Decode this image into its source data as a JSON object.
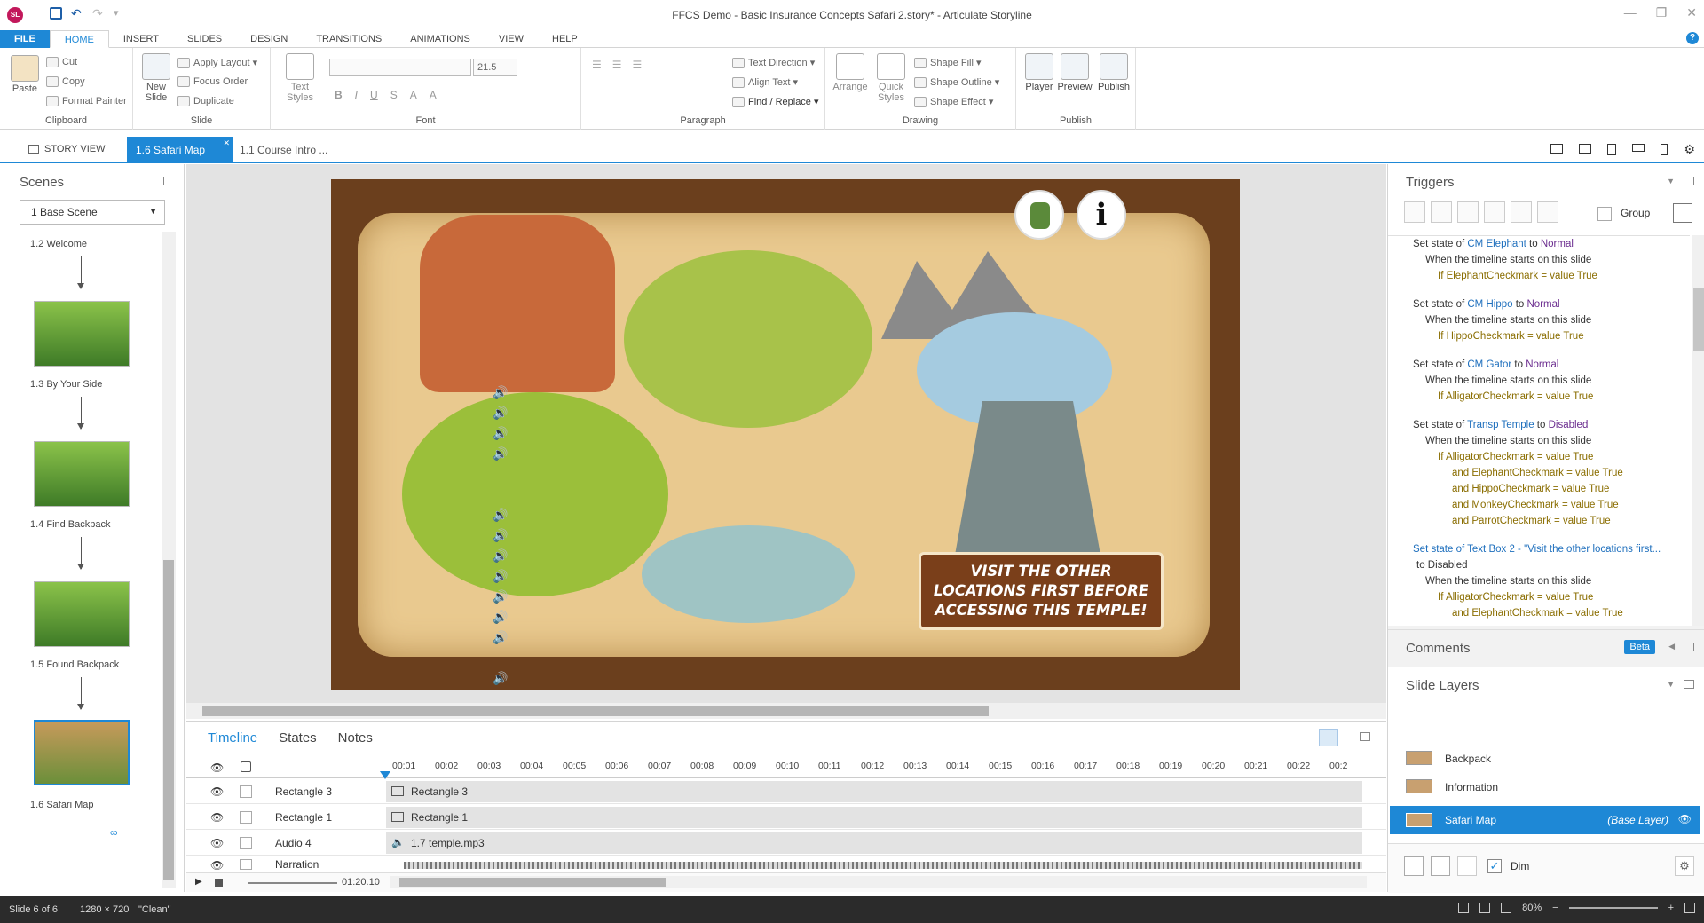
{
  "titlebar": {
    "title": "FFCS Demo - Basic Insurance Concepts Safari 2.story* - Articulate Storyline",
    "app_badge": "SL"
  },
  "menu_tabs": [
    "FILE",
    "HOME",
    "INSERT",
    "SLIDES",
    "DESIGN",
    "TRANSITIONS",
    "ANIMATIONS",
    "VIEW",
    "HELP"
  ],
  "ribbon": {
    "clipboard": {
      "paste": "Paste",
      "cut": "Cut",
      "copy": "Copy",
      "format_painter": "Format Painter",
      "label": "Clipboard"
    },
    "slide": {
      "new_slide": "New Slide",
      "apply_layout": "Apply Layout",
      "focus_order": "Focus Order",
      "duplicate": "Duplicate",
      "label": "Slide"
    },
    "font": {
      "text_styles": "Text Styles",
      "font_size": "21.5",
      "label": "Font"
    },
    "paragraph": {
      "text_direction": "Text Direction",
      "align_text": "Align Text",
      "find_replace": "Find / Replace",
      "label": "Paragraph"
    },
    "drawing": {
      "arrange": "Arrange",
      "quick_styles": "Quick Styles",
      "shape_fill": "Shape Fill",
      "shape_outline": "Shape Outline",
      "shape_effect": "Shape Effect",
      "label": "Drawing"
    },
    "publish": {
      "player": "Player",
      "preview": "Preview",
      "publish": "Publish",
      "label": "Publish"
    }
  },
  "doc_tabs": {
    "story_view": "STORY VIEW",
    "active": "1.6 Safari Map",
    "other": "1.1 Course Intro ..."
  },
  "scenes": {
    "title": "Scenes",
    "dropdown": "1 Base Scene",
    "items": [
      "1.2 Welcome",
      "1.3 By Your Side",
      "1.4 Find Backpack",
      "1.5 Found Backpack",
      "1.6 Safari Map"
    ]
  },
  "slide": {
    "banner_text": "VISIT THE OTHER LOCATIONS FIRST BEFORE ACCESSING THIS TEMPLE!"
  },
  "timeline": {
    "tabs": [
      "Timeline",
      "States",
      "Notes"
    ],
    "ticks": [
      "00:01",
      "00:02",
      "00:03",
      "00:04",
      "00:05",
      "00:06",
      "00:07",
      "00:08",
      "00:09",
      "00:10",
      "00:11",
      "00:12",
      "00:13",
      "00:14",
      "00:15",
      "00:16",
      "00:17",
      "00:18",
      "00:19",
      "00:20",
      "00:21",
      "00:22",
      "00:2"
    ],
    "rows": [
      {
        "name": "Rectangle 3",
        "bar": "Rectangle 3"
      },
      {
        "name": "Rectangle 1",
        "bar": "Rectangle 1"
      },
      {
        "name": "Audio 4",
        "bar": "1.7 temple.mp3"
      },
      {
        "name": "Narration",
        "bar": ""
      }
    ],
    "duration": "01:20.10"
  },
  "triggers": {
    "title": "Triggers",
    "group_label": "Group",
    "items": [
      {
        "l1a": "Set state of ",
        "l1b": "CM Elephant",
        "l1c": " to ",
        "l1d": "Normal",
        "l2": "When the timeline starts on this slide",
        "l3": "If ElephantCheckmark = value True"
      },
      {
        "l1a": "Set state of ",
        "l1b": "CM Hippo",
        "l1c": " to ",
        "l1d": "Normal",
        "l2": "When the timeline starts on this slide",
        "l3": "If HippoCheckmark = value True"
      },
      {
        "l1a": "Set state of ",
        "l1b": "CM Gator",
        "l1c": " to ",
        "l1d": "Normal",
        "l2": "When the timeline starts on this slide",
        "l3": "If AlligatorCheckmark = value True"
      }
    ],
    "temple": {
      "l1a": "Set state of ",
      "l1b": "Transp Temple",
      "l1c": " to ",
      "l1d": "Disabled",
      "l2": "When the timeline starts on this slide",
      "conds": [
        "If AlligatorCheckmark = value True",
        "and ElephantCheckmark = value True",
        "and HippoCheckmark = value True",
        "and MonkeyCheckmark = value True",
        "and ParrotCheckmark = value True"
      ]
    },
    "textbox": {
      "l1": "Set state of Text Box 2 - \"Visit the other locations first...",
      "l1b": "to Disabled",
      "l2": "When the timeline starts on this slide",
      "conds": [
        "If AlligatorCheckmark = value True",
        "and ElephantCheckmark = value True"
      ]
    }
  },
  "comments": {
    "title": "Comments",
    "badge": "Beta"
  },
  "layers": {
    "title": "Slide Layers",
    "items": [
      {
        "name": "Backpack"
      },
      {
        "name": "Information"
      }
    ],
    "base": {
      "name": "Safari Map",
      "tag": "(Base Layer)"
    },
    "dim": "Dim"
  },
  "status": {
    "slide": "Slide 6 of 6",
    "size": "1280 × 720",
    "theme": "\"Clean\"",
    "zoom": "80%"
  }
}
